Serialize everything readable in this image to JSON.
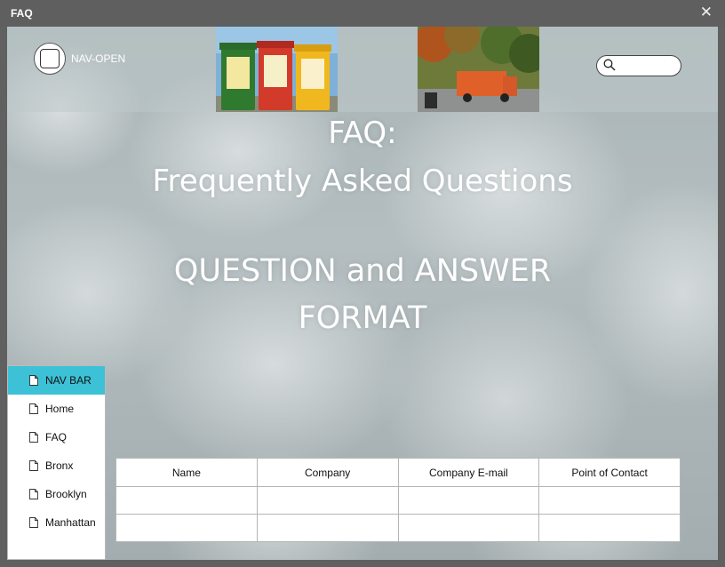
{
  "window": {
    "title": "FAQ",
    "close_glyph": "✕"
  },
  "header": {
    "nav_open_label": "NAV-OPEN",
    "search": {
      "value": "",
      "placeholder": ""
    },
    "images": [
      "waste-bins-photo",
      "garbage-truck-photo"
    ]
  },
  "hero": {
    "line1": "FAQ:",
    "line2": "Frequently Asked Questions",
    "line3": "QUESTION and ANSWER",
    "line4": "FORMAT"
  },
  "sidenav": {
    "accent_color": "#3cc1d6",
    "items": [
      {
        "label": "NAV BAR",
        "icon": "document-icon",
        "active": true
      },
      {
        "label": "Home",
        "icon": "document-icon"
      },
      {
        "label": "FAQ",
        "icon": "document-icon"
      },
      {
        "label": "Bronx",
        "icon": "document-icon"
      },
      {
        "label": "Brooklyn",
        "icon": "document-icon"
      },
      {
        "label": "Manhattan",
        "icon": "document-icon"
      }
    ]
  },
  "contact_table": {
    "columns": [
      "Name",
      "Company",
      "Company E-mail",
      "Point of Contact"
    ],
    "rows": [
      [
        "",
        "",
        "",
        ""
      ],
      [
        "",
        "",
        "",
        ""
      ]
    ]
  }
}
